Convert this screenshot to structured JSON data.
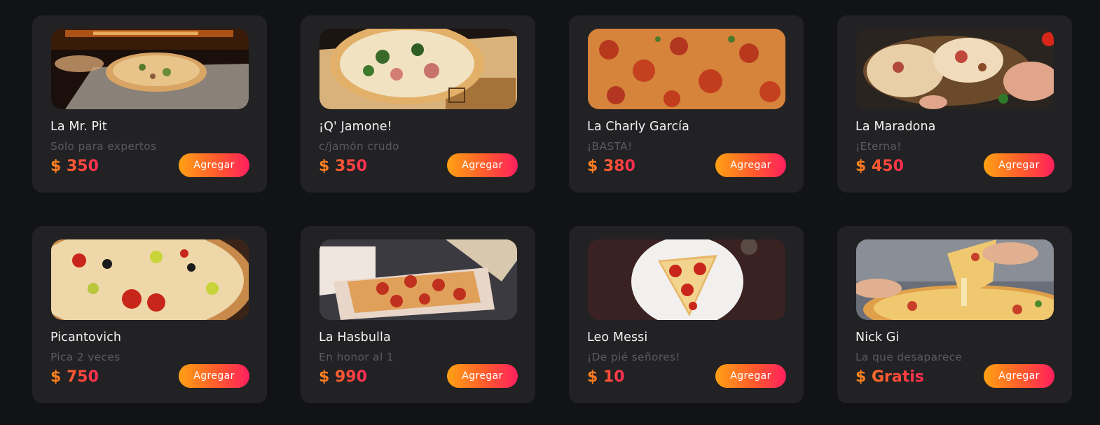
{
  "products": [
    {
      "name": "La Mr. Pit",
      "description": "Solo para expertos",
      "price": "$ 350",
      "button_label": "Agregar"
    },
    {
      "name": "¡Q' Jamone!",
      "description": "c/jamón crudo",
      "price": "$ 350",
      "button_label": "Agregar"
    },
    {
      "name": "La Charly García",
      "description": "¡BASTA!",
      "price": "$ 380",
      "button_label": "Agregar"
    },
    {
      "name": "La Maradona",
      "description": "¡Eterna!",
      "price": "$ 450",
      "button_label": "Agregar"
    },
    {
      "name": "Picantovich",
      "description": "Pica 2 veces",
      "price": "$ 750",
      "button_label": "Agregar"
    },
    {
      "name": "La Hasbulla",
      "description": "En honor al 1",
      "price": "$ 990",
      "button_label": "Agregar"
    },
    {
      "name": "Leo Messi",
      "description": "¡De pié señores!",
      "price": "$ 10",
      "button_label": "Agregar"
    },
    {
      "name": "Nick Gi",
      "description": "La que desaparece",
      "price": "$ Gratis",
      "button_label": "Agregar"
    }
  ],
  "colors": {
    "background": "#121315",
    "card": "#222224",
    "accent_start": "#ffa114",
    "accent_end": "#ff1f5e"
  }
}
